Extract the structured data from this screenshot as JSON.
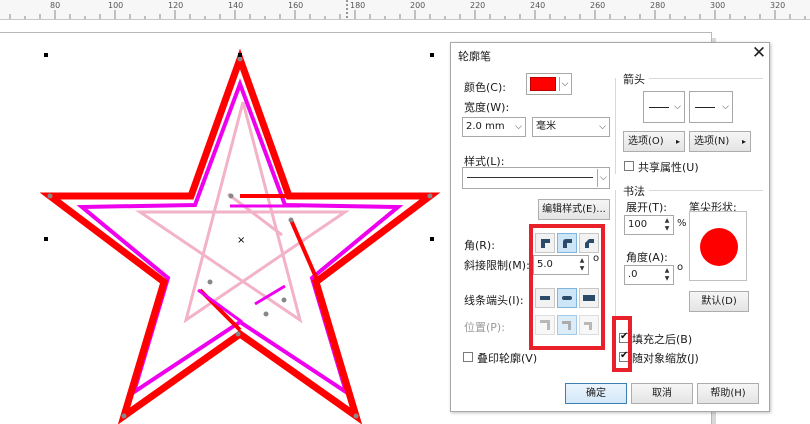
{
  "ruler": {
    "ticks": [
      "80",
      "100",
      "120",
      "140",
      "160",
      "180",
      "200",
      "220",
      "240",
      "260",
      "280",
      "300",
      "320"
    ]
  },
  "dialog": {
    "title": "轮廓笔",
    "close": "✕",
    "color_label": "颜色(C):",
    "color_value": "#ff0000",
    "width_label": "宽度(W):",
    "width_value": "2.0 mm",
    "width_unit": "毫米",
    "style_label": "样式(L):",
    "edit_style_button": "编辑样式(E)...",
    "corner_label": "角(R):",
    "miter_label": "斜接限制(M):",
    "miter_value": "5.0",
    "degree_symbol": "o",
    "linecap_label": "线条端头(I):",
    "position_label": "位置(P):",
    "overprint_label": "叠印轮廓(V)",
    "arrows": {
      "title": "箭头",
      "options_left": "选项(O)",
      "options_right": "选项(N)",
      "share_label": "共享属性(U)"
    },
    "calligraphy": {
      "title": "书法",
      "stretch_label": "展开(T):",
      "stretch_value": "100",
      "percent": "%",
      "angle_label": "角度(A):",
      "angle_value": ".0",
      "nib_label": "笔尖形状:",
      "default_button": "默认(D)"
    },
    "fill_behind_label": "填充之后(B)",
    "scale_with_label": "随对象缩放(J)",
    "ok": "确定",
    "cancel": "取消",
    "help": "帮助(H)"
  },
  "colors": {
    "outline_red": "#ff0000",
    "magenta": "#ee00ee",
    "pink": "#f2b2c8",
    "annotation": "#e8202a"
  }
}
